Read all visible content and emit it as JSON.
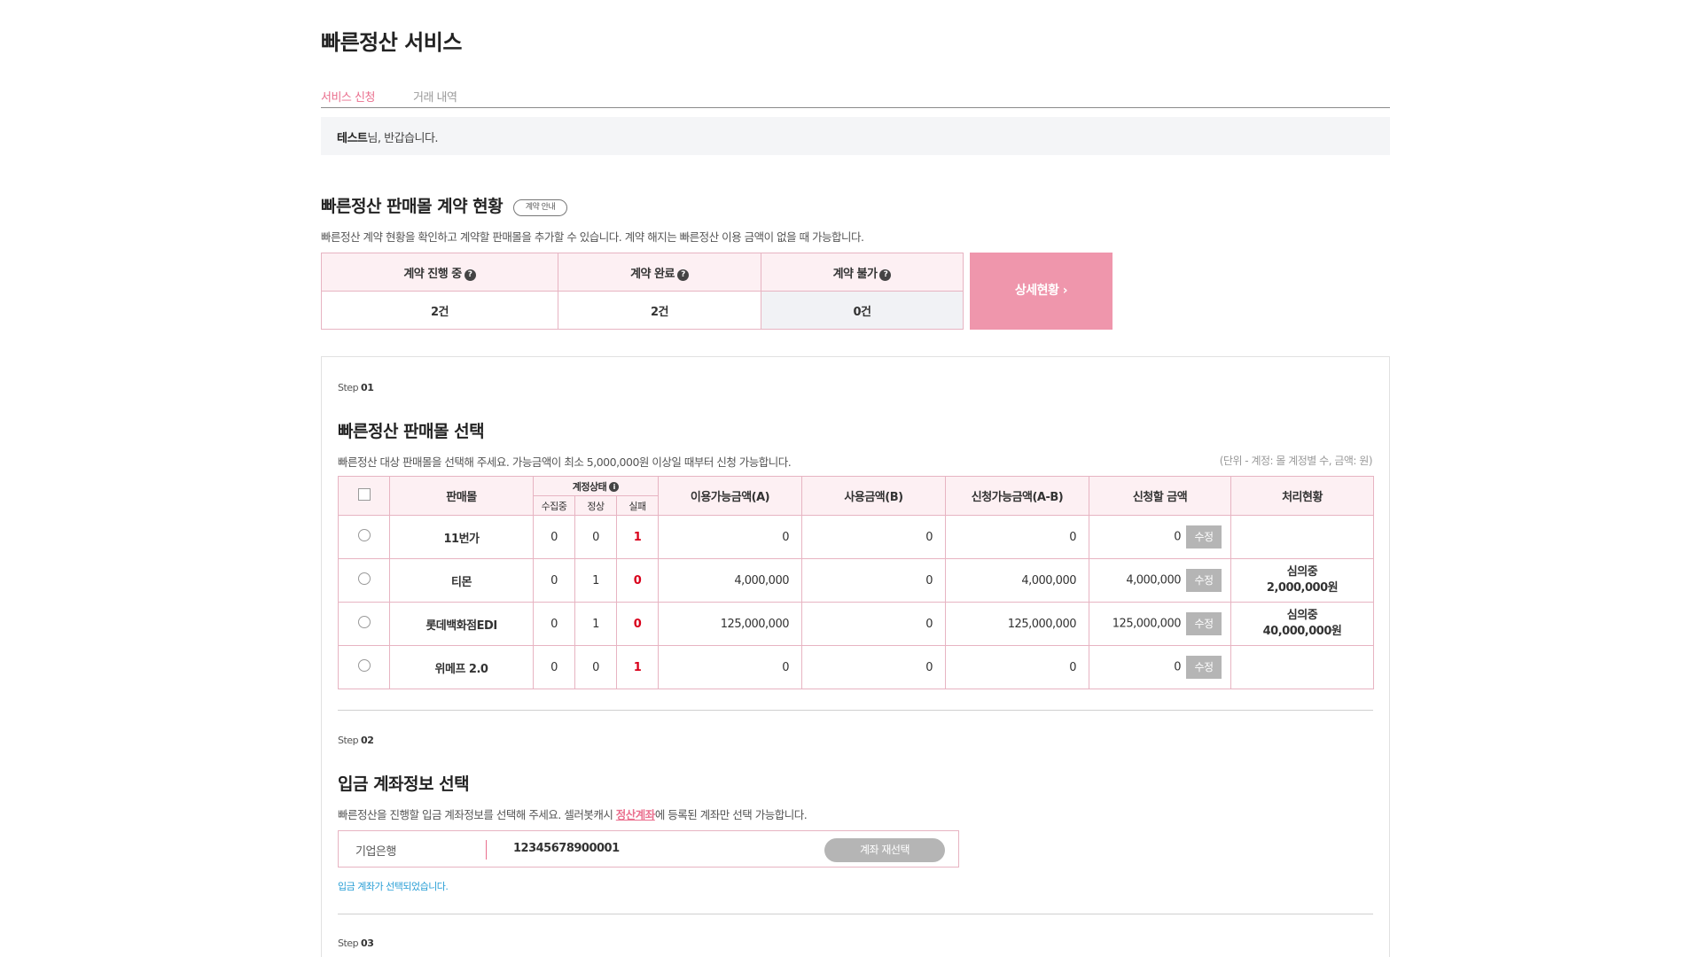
{
  "page_title": "빠른정산 서비스",
  "tabs": [
    {
      "label": "서비스 신청",
      "active": true
    },
    {
      "label": "거래 내역",
      "active": false
    }
  ],
  "welcome": {
    "name": "테스트",
    "suffix": "님, 반갑습니다."
  },
  "contract": {
    "title": "빠른정산 판매몰 계약 현황",
    "info_button": "계약 안내",
    "desc": "빠른정산 계약 현황을 확인하고 계약할 판매몰을 추가할 수 있습니다. 계약 해지는 빠른정산 이용 금액이 없을 때 가능합니다.",
    "headers": [
      "계약 진행 중",
      "계약 완료",
      "계약 불가"
    ],
    "values": [
      "2건",
      "2건",
      "0건"
    ],
    "detail_button": "상세현황 ›"
  },
  "step1": {
    "label_prefix": "Step",
    "label_num": "01",
    "title": "빠른정산 판매몰 선택",
    "desc": "빠른정산 대상 판매몰을 선택해 주세요. 가능금액이 최소 5,000,000원 이상일 때부터 신청 가능합니다.",
    "unit_note": "(단위 - 계정: 몰 계정별 수, 금액: 원)",
    "headers": {
      "mall": "판매몰",
      "account_status": "계정상태",
      "collecting": "수집중",
      "normal": "정상",
      "failed": "실패",
      "available": "이용가능금액(A)",
      "used": "사용금액(B)",
      "applicable": "신청가능금액(A-B)",
      "apply_amount": "신청할 금액",
      "process": "처리현황"
    },
    "edit_label": "수정",
    "rows": [
      {
        "mall": "11번가",
        "collecting": "0",
        "normal": "0",
        "failed": "1",
        "available": "0",
        "used": "0",
        "applicable": "0",
        "apply": "0",
        "status1": "",
        "status2": ""
      },
      {
        "mall": "티몬",
        "collecting": "0",
        "normal": "1",
        "failed": "0",
        "available": "4,000,000",
        "used": "0",
        "applicable": "4,000,000",
        "apply": "4,000,000",
        "status1": "심의중",
        "status2": "2,000,000원"
      },
      {
        "mall": "롯데백화점EDI",
        "collecting": "0",
        "normal": "1",
        "failed": "0",
        "available": "125,000,000",
        "used": "0",
        "applicable": "125,000,000",
        "apply": "125,000,000",
        "status1": "심의중",
        "status2": "40,000,000원"
      },
      {
        "mall": "위메프 2.0",
        "collecting": "0",
        "normal": "0",
        "failed": "1",
        "available": "0",
        "used": "0",
        "applicable": "0",
        "apply": "0",
        "status1": "",
        "status2": ""
      }
    ]
  },
  "step2": {
    "label_prefix": "Step",
    "label_num": "02",
    "title": "입금 계좌정보 선택",
    "desc_before": "빠른정산을 진행할 입금 계좌정보를 선택해 주세요. 셀러봇캐시 ",
    "desc_link": "정산계좌",
    "desc_after": "에 등록된 계좌만 선택 가능합니다.",
    "bank": "기업은행",
    "account_number": "12345678900001",
    "reselect_button": "계좌 재선택",
    "notice": "입금 계좌가 선택되었습니다."
  },
  "step3": {
    "label_prefix": "Step",
    "label_num": "03"
  },
  "colors": {
    "accent_pink": "#ea6f8e",
    "button_pink": "#ef96ac",
    "header_bg": "#fdf0f3",
    "fail_red": "#d9001b",
    "notice_blue": "#2a9fd6"
  }
}
